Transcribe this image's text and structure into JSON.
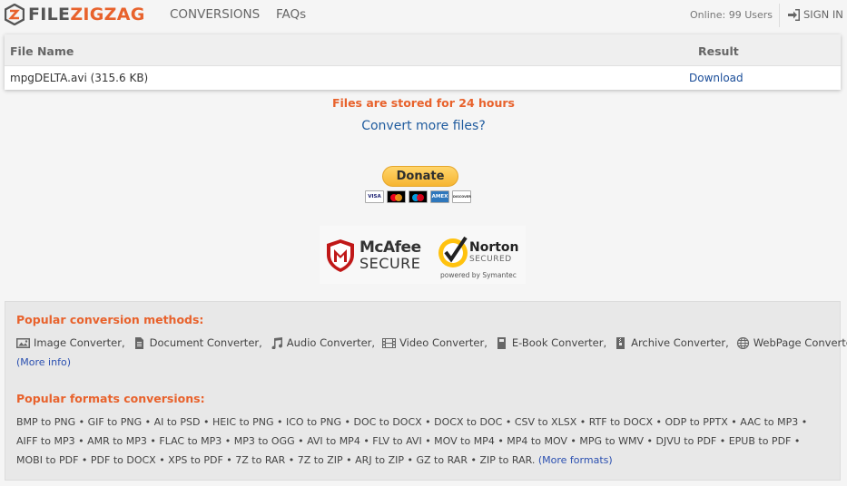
{
  "header": {
    "logo_text_left": "FILE",
    "logo_text_right": "ZIGZAG",
    "nav": [
      "CONVERSIONS",
      "FAQs"
    ],
    "online": "Online: 99 Users",
    "sign_in": "SIGN IN"
  },
  "table": {
    "headers": {
      "file": "File Name",
      "result": "Result"
    },
    "rows": [
      {
        "file": "mpgDELTA.avi (315.6 KB)",
        "result": "Download"
      }
    ]
  },
  "notice": "Files are stored for 24 hours",
  "convert_more": "Convert more files?",
  "donate": {
    "label": "Donate",
    "cards": [
      "VISA",
      "",
      "",
      "AMEX",
      "DISCOVER"
    ]
  },
  "badges": {
    "mcafee_brand": "McAfee",
    "mcafee_secure": "SECURE",
    "norton_name": "Norton",
    "norton_secured": "SECURED",
    "norton_powered": "powered by Symantec"
  },
  "popular_methods": {
    "title": "Popular conversion methods:",
    "items": [
      {
        "label": "Image Converter",
        "icon": "image-icon"
      },
      {
        "label": "Document Converter",
        "icon": "document-icon"
      },
      {
        "label": "Audio Converter",
        "icon": "music-note-icon"
      },
      {
        "label": "Video Converter",
        "icon": "film-icon"
      },
      {
        "label": "E-Book Converter",
        "icon": "book-icon"
      },
      {
        "label": "Archive Converter",
        "icon": "archive-icon"
      },
      {
        "label": "WebPage Converter",
        "icon": "globe-icon"
      }
    ],
    "more_info": "(More info)"
  },
  "popular_formats": {
    "title": "Popular formats conversions:",
    "lines": [
      "BMP to PNG • GIF to PNG • AI to PSD • HEIC to PNG • ICO to PNG • DOC to DOCX • DOCX to DOC • CSV to XLSX • RTF to DOCX • ODP to PPTX • AAC to MP3 •",
      "AIFF to MP3 • AMR to MP3 • FLAC to MP3 • MP3 to OGG • AVI to MP4 • FLV to AVI • MOV to MP4 • MP4 to MOV • MPG to WMV • DJVU to PDF • EPUB to PDF •",
      "MOBI to PDF • PDF to DOCX • XPS to PDF • 7Z to RAR • 7Z to ZIP • ARJ to ZIP • GZ to RAR • ZIP to RAR."
    ],
    "more_formats": "(More formats)"
  },
  "colors": {
    "accent": "#e8622c",
    "link": "#1f5b9e"
  }
}
